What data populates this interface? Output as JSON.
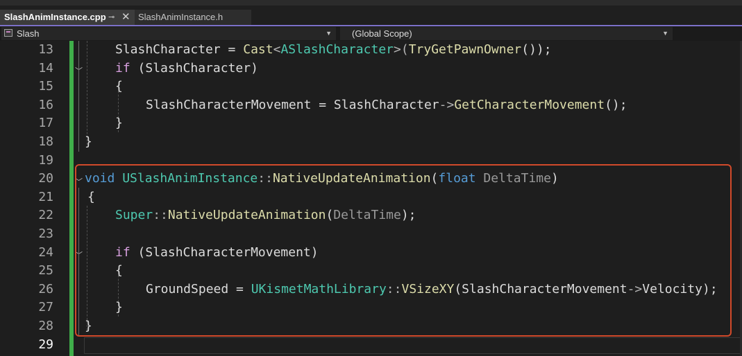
{
  "tabs": [
    {
      "label": "SlashAnimInstance.cpp",
      "active": true,
      "pin_icon": "pin-icon",
      "close_icon": "close-icon"
    },
    {
      "label": "SlashAnimInstance.h",
      "active": false
    }
  ],
  "nav": {
    "project": "Slash",
    "scope": "(Global Scope)"
  },
  "editor": {
    "line_numbers": [
      "13",
      "14",
      "15",
      "16",
      "17",
      "18",
      "19",
      "20",
      "21",
      "22",
      "23",
      "24",
      "25",
      "26",
      "27",
      "28",
      "29"
    ],
    "current_line": "29",
    "highlight_color": "#d24a2a",
    "lines": [
      [
        {
          "t": "SlashCharacter = "
        },
        {
          "t": "Cast",
          "c": "fn"
        },
        {
          "t": "<",
          "c": "punc"
        },
        {
          "t": "ASlashCharacter",
          "c": "ty"
        },
        {
          "t": ">(",
          "c": "punc"
        },
        {
          "t": "TryGetPawnOwner",
          "c": "fn"
        },
        {
          "t": "());"
        }
      ],
      [
        {
          "t": "if",
          "c": "ctl"
        },
        {
          "t": " (SlashCharacter)"
        }
      ],
      [
        {
          "t": "{"
        }
      ],
      [
        {
          "t": "SlashCharacterMovement = SlashCharacter"
        },
        {
          "t": "->",
          "c": "punc"
        },
        {
          "t": "GetCharacterMovement",
          "c": "fn"
        },
        {
          "t": "();"
        }
      ],
      [
        {
          "t": "}"
        }
      ],
      [
        {
          "t": "}"
        }
      ],
      [
        {
          "t": ""
        }
      ],
      [
        {
          "t": "void",
          "c": "kw"
        },
        {
          "t": " "
        },
        {
          "t": "USlashAnimInstance",
          "c": "ty"
        },
        {
          "t": "::",
          "c": "punc"
        },
        {
          "t": "NativeUpdateAnimation",
          "c": "fn"
        },
        {
          "t": "("
        },
        {
          "t": "float",
          "c": "kw"
        },
        {
          "t": " "
        },
        {
          "t": "DeltaTime",
          "c": "prm"
        },
        {
          "t": ")"
        }
      ],
      [
        {
          "t": "{"
        }
      ],
      [
        {
          "t": "Super",
          "c": "ty"
        },
        {
          "t": "::",
          "c": "punc"
        },
        {
          "t": "NativeUpdateAnimation",
          "c": "fn"
        },
        {
          "t": "("
        },
        {
          "t": "DeltaTime",
          "c": "prm"
        },
        {
          "t": ");"
        }
      ],
      [
        {
          "t": ""
        }
      ],
      [
        {
          "t": "if",
          "c": "ctl"
        },
        {
          "t": " (SlashCharacterMovement)"
        }
      ],
      [
        {
          "t": "{"
        }
      ],
      [
        {
          "t": "GroundSpeed = "
        },
        {
          "t": "UKismetMathLibrary",
          "c": "ty"
        },
        {
          "t": "::",
          "c": "punc"
        },
        {
          "t": "VSizeXY",
          "c": "fn"
        },
        {
          "t": "(SlashCharacterMovement"
        },
        {
          "t": "->",
          "c": "punc"
        },
        {
          "t": "Velocity);"
        }
      ],
      [
        {
          "t": "}"
        }
      ],
      [
        {
          "t": "}"
        }
      ],
      [
        {
          "t": ""
        }
      ]
    ]
  }
}
